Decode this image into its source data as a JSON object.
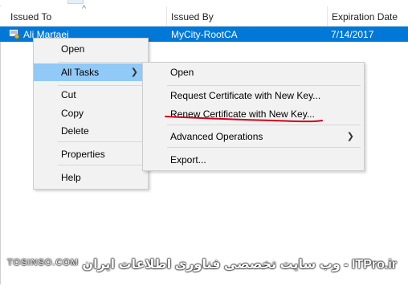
{
  "columns": {
    "issued_to": "Issued To",
    "issued_by": "Issued By",
    "expiration_date": "Expiration Date"
  },
  "selected_row": {
    "issued_to": "Ali Martaei",
    "issued_by": "MyCity-RootCA",
    "expiration_date": "7/14/2017"
  },
  "context_menu": {
    "open": "Open",
    "all_tasks": "All Tasks",
    "cut": "Cut",
    "copy": "Copy",
    "delete": "Delete",
    "properties": "Properties",
    "help": "Help"
  },
  "submenu": {
    "open": "Open",
    "request_new_key": "Request Certificate with New Key...",
    "renew_new_key": "Renew Certificate with New Key...",
    "advanced_operations": "Advanced Operations",
    "export": "Export..."
  },
  "watermark": {
    "left": "TOSINSO.COM",
    "right": "ITPro.ir - وب سایت تخصصی فناوری اطلاعات ایران"
  },
  "colors": {
    "selection": "#0078d7",
    "menu_highlight": "#91c9f7",
    "annotation_line": "#d0021b"
  }
}
